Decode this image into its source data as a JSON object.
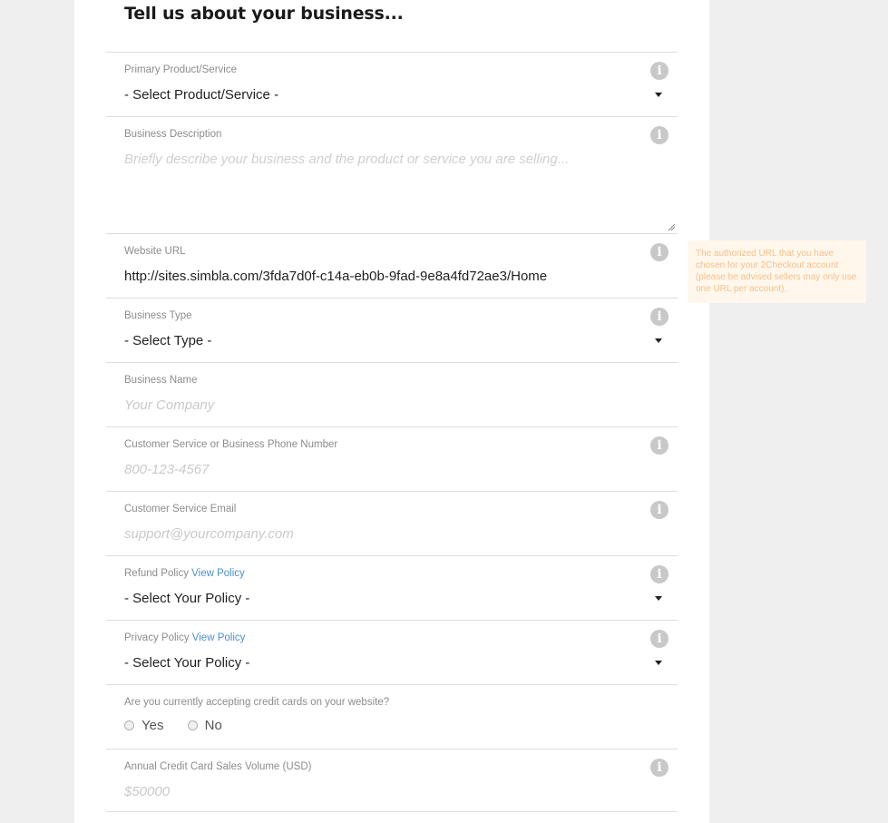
{
  "heading": "Tell us about your business...",
  "tooltip": "The authorized URL that you have chosen for your 2Checkout account (please be advised sellers may only use one URL per account).",
  "fields": {
    "product": {
      "label": "Primary Product/Service",
      "value": "- Select Product/Service -"
    },
    "description": {
      "label": "Business Description",
      "placeholder": "Briefly describe your business and the product or service you are selling..."
    },
    "website": {
      "label": "Website URL",
      "value": "http://sites.simbla.com/3fda7d0f-c14a-eb0b-9fad-9e8a4fd72ae3/Home"
    },
    "business_type": {
      "label": "Business Type",
      "value": "- Select Type -"
    },
    "business_name": {
      "label": "Business Name",
      "placeholder": "Your Company"
    },
    "phone": {
      "label": "Customer Service or Business Phone Number",
      "placeholder": "800-123-4567"
    },
    "email": {
      "label": "Customer Service Email",
      "placeholder": "support@yourcompany.com"
    },
    "refund": {
      "label": "Refund Policy",
      "link": "View Policy",
      "value": "- Select Your Policy -"
    },
    "privacy": {
      "label": "Privacy Policy",
      "link": "View Policy",
      "value": "- Select Your Policy -"
    },
    "accepting_cards": {
      "label": "Are you currently accepting credit cards on your website?",
      "options": [
        "Yes",
        "No"
      ]
    },
    "sales_volume": {
      "label": "Annual Credit Card Sales Volume (USD)",
      "placeholder": "$50000"
    }
  },
  "icons": {
    "info": "info-icon",
    "caret": "caret-down-icon"
  }
}
